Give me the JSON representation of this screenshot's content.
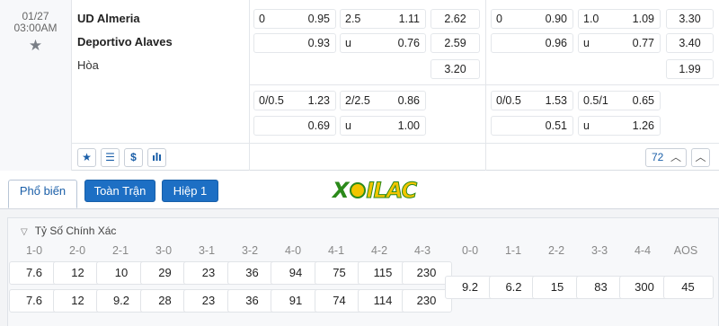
{
  "match": {
    "date": "01/27",
    "time": "03:00AM",
    "home": "UD Almeria",
    "away": "Deportivo Alaves",
    "draw": "Hòa",
    "odds_rows": [
      {
        "ah_line": "0",
        "ah_home": "0.95",
        "ou_line": "2.5",
        "ou_over": "1.11",
        "x12_1": "2.62",
        "ah2_line": "0",
        "ah2_home": "0.90",
        "ou2_line": "1.0",
        "ou2_over": "1.09",
        "x12b_1": "3.30"
      },
      {
        "ah_away": "0.93",
        "ou_u": "u",
        "ou_under": "0.76",
        "x12_2": "2.59",
        "ah2_away": "0.96",
        "ou2_u": "u",
        "ou2_under": "0.77",
        "x12b_2": "3.40"
      },
      {
        "x12_x": "3.20",
        "x12b_x": "1.99"
      },
      {
        "ah_line": "0/0.5",
        "ah_home": "1.23",
        "ou_line": "2/2.5",
        "ou_over": "0.86",
        "ah2_line": "0/0.5",
        "ah2_home": "1.53",
        "ou2_line": "0.5/1",
        "ou2_over": "0.65"
      },
      {
        "ah_away": "0.69",
        "ou_u": "u",
        "ou_under": "1.00",
        "ah2_away": "0.51",
        "ou2_u": "u",
        "ou2_under": "1.26"
      }
    ],
    "more_count": "72"
  },
  "toolbar_icons": [
    "star-icon",
    "list-icon",
    "dollar-icon",
    "bar-chart-icon",
    "chevron-up-icon"
  ],
  "tabs": {
    "popular": "Phổ biến",
    "full_match": "Toàn Trận",
    "half": "Hiệp 1"
  },
  "logo": {
    "x": "X",
    "rest": "ILAC"
  },
  "correct_score": {
    "title": "Tỷ Số Chính Xác",
    "headers": [
      "1-0",
      "2-0",
      "2-1",
      "3-0",
      "3-1",
      "3-2",
      "4-0",
      "4-1",
      "4-2",
      "4-3",
      "0-0",
      "1-1",
      "2-2",
      "3-3",
      "4-4",
      "AOS"
    ],
    "home_row": [
      "7.6",
      "12",
      "10",
      "29",
      "23",
      "36",
      "94",
      "75",
      "115",
      "230"
    ],
    "away_row": [
      "7.6",
      "12",
      "9.2",
      "28",
      "23",
      "36",
      "91",
      "74",
      "114",
      "230"
    ],
    "draw_row": [
      "9.2",
      "6.2",
      "15",
      "83",
      "300",
      "45"
    ]
  },
  "colors": {
    "accent": "#1d6fc4",
    "logo_green": "#2b8a1a",
    "logo_yellow": "#f2c500"
  }
}
